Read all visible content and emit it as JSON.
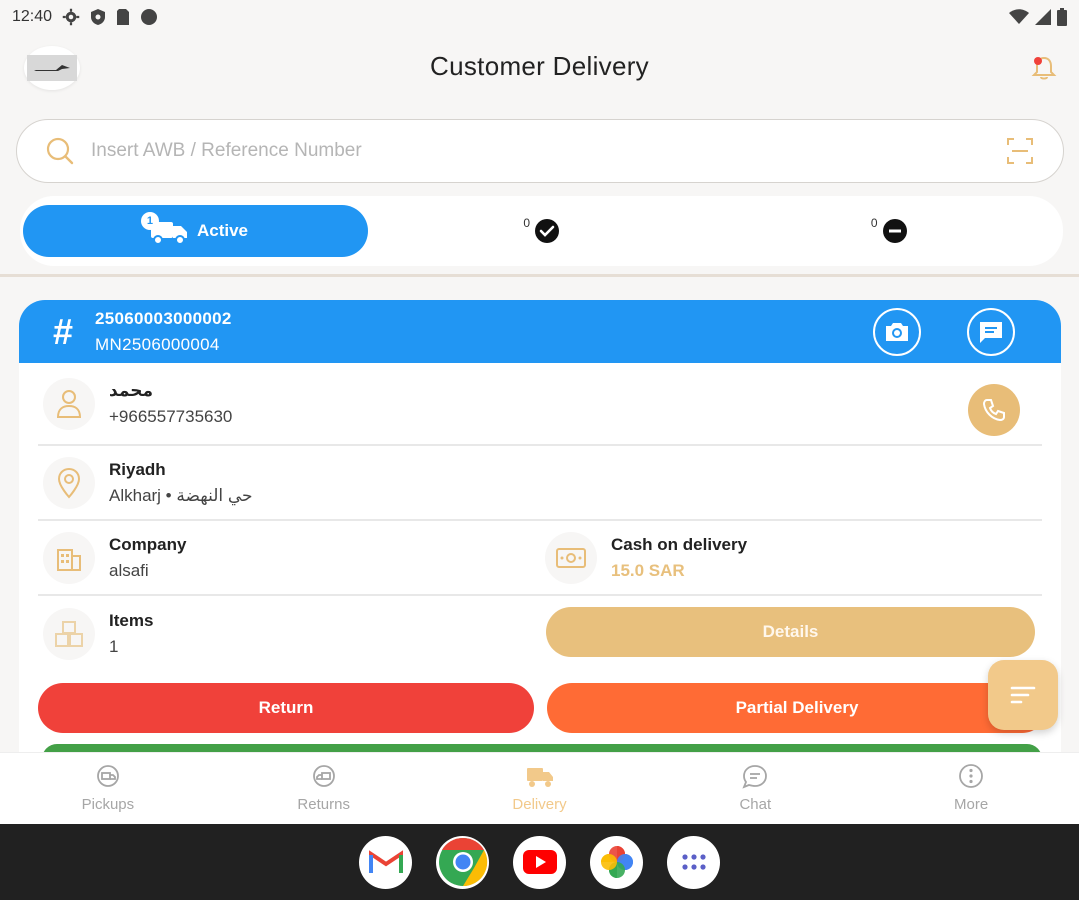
{
  "status_bar": {
    "time": "12:40"
  },
  "header": {
    "title": "Customer Delivery"
  },
  "search": {
    "placeholder": "Insert AWB / Reference Number"
  },
  "tabs": {
    "active": {
      "label": "Active",
      "badge": "1"
    },
    "delivered": {
      "count": "0"
    },
    "failed": {
      "count": "0"
    }
  },
  "shipment": {
    "awb": "25060003000002",
    "reference": "MN2506000004",
    "customer_name": "محمد",
    "phone": "+966557735630",
    "city": "Riyadh",
    "area": "Alkharj • حي النهضة",
    "company_label": "Company",
    "company": "alsafi",
    "payment_label": "Cash on delivery",
    "amount": "15.0 SAR",
    "items_label": "Items",
    "items": "1"
  },
  "actions": {
    "details": "Details",
    "return": "Return",
    "partial": "Partial Delivery"
  },
  "bottom_nav": [
    {
      "label": "Pickups"
    },
    {
      "label": "Returns"
    },
    {
      "label": "Delivery"
    },
    {
      "label": "Chat"
    },
    {
      "label": "More"
    }
  ],
  "colors": {
    "primary": "#2196f3",
    "gold": "#e8bd78",
    "return": "#f0413a",
    "partial": "#ff6b35",
    "success": "#43a047"
  }
}
